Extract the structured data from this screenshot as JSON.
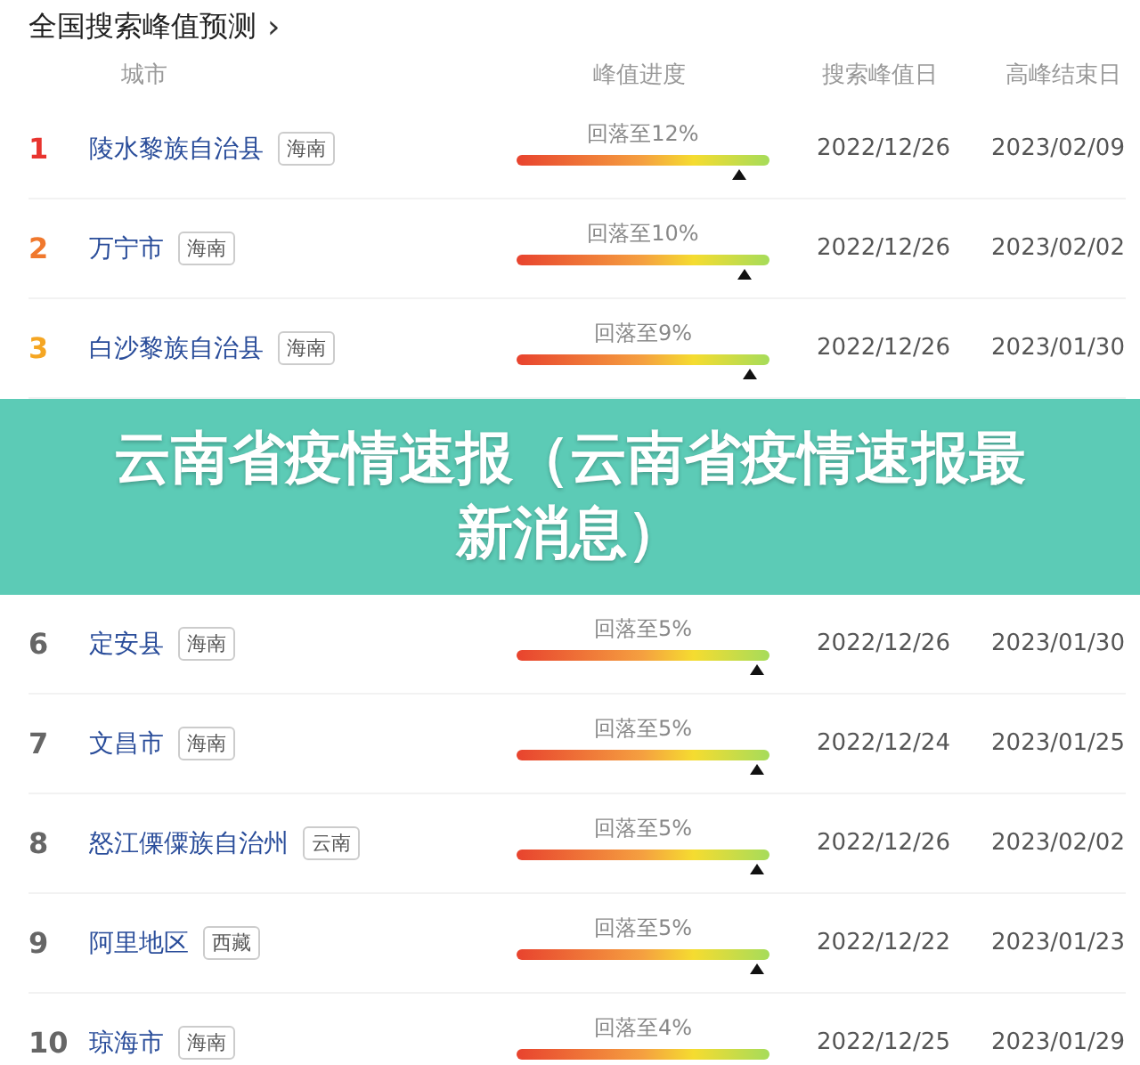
{
  "title": "全国搜索峰值预测",
  "title_arrow": "›",
  "columns": [
    "城市",
    "峰值进度",
    "搜索峰值日",
    "高峰结束日"
  ],
  "rows": [
    {
      "rank": "1",
      "color": "#e8342f",
      "city": "陵水黎族自治县",
      "province": "海南",
      "progress": "回落至12%",
      "level": 0.88,
      "peak": "2022/12/26",
      "end": "2023/02/09"
    },
    {
      "rank": "2",
      "color": "#f0782d",
      "city": "万宁市",
      "province": "海南",
      "progress": "回落至10%",
      "level": 0.9,
      "peak": "2022/12/26",
      "end": "2023/02/02"
    },
    {
      "rank": "3",
      "color": "#f5a623",
      "city": "白沙黎族自治县",
      "province": "海南",
      "progress": "回落至9%",
      "level": 0.92,
      "peak": "2022/12/26",
      "end": "2023/01/30"
    },
    {
      "rank": "6",
      "color": "#666666",
      "city": "定安县",
      "province": "海南",
      "progress": "回落至5%",
      "level": 0.95,
      "peak": "2022/12/26",
      "end": "2023/01/30"
    },
    {
      "rank": "7",
      "color": "#666666",
      "city": "文昌市",
      "province": "海南",
      "progress": "回落至5%",
      "level": 0.95,
      "peak": "2022/12/24",
      "end": "2023/01/25"
    },
    {
      "rank": "8",
      "color": "#666666",
      "city": "怒江傈僳族自治州",
      "province": "云南",
      "progress": "回落至5%",
      "level": 0.95,
      "peak": "2022/12/26",
      "end": "2023/02/02"
    },
    {
      "rank": "9",
      "color": "#666666",
      "city": "阿里地区",
      "province": "西藏",
      "progress": "回落至5%",
      "level": 0.95,
      "peak": "2022/12/22",
      "end": "2023/01/23"
    },
    {
      "rank": "10",
      "color": "#666666",
      "city": "琼海市",
      "province": "海南",
      "progress": "回落至4%",
      "peak": "2022/12/25",
      "end": "2023/01/29"
    }
  ],
  "banner": "云南省疫情速报（云南省疫情速报最新消息）"
}
